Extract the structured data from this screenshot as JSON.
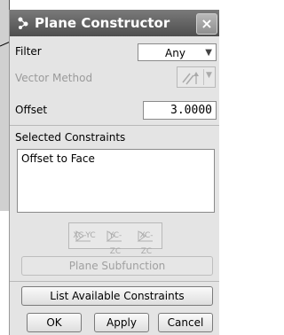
{
  "dialog": {
    "title": "Plane Constructor",
    "close_label": "×"
  },
  "filter": {
    "label": "Filter",
    "value": "Any"
  },
  "vector_method": {
    "label": "Vector Method"
  },
  "offset": {
    "label": "Offset",
    "value": "3.0000"
  },
  "constraints": {
    "heading": "Selected Constraints",
    "items": [
      "Offset to Face"
    ]
  },
  "direction_icons": [
    {
      "label": "XC-YC",
      "icon": "xc-yc-plane-icon"
    },
    {
      "label": "YC-ZC",
      "icon": "yc-zc-plane-icon"
    },
    {
      "label": "XC-ZC",
      "icon": "xc-zc-plane-icon"
    }
  ],
  "buttons": {
    "plane_subfunction": "Plane Subfunction",
    "list_constraints": "List Available Constraints",
    "ok": "OK",
    "apply": "Apply",
    "cancel": "Cancel"
  },
  "colors": {
    "titlebar": "#5e5e5e",
    "dialog_bg": "#e4e4e4",
    "disabled_text": "#9a9a9a"
  }
}
